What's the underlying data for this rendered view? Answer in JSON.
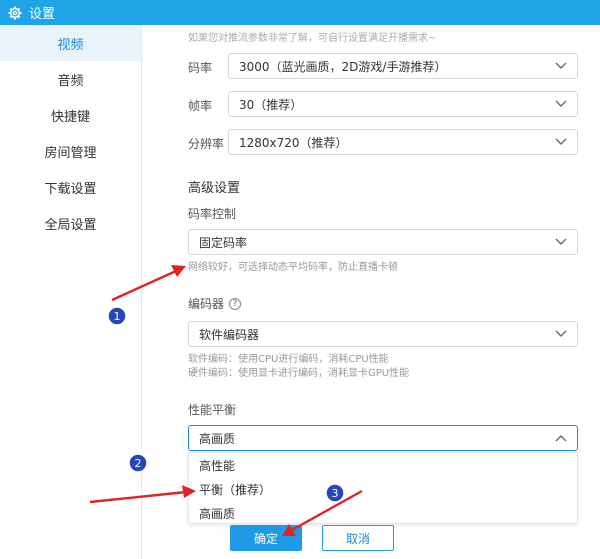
{
  "window": {
    "title": "设置",
    "icon": "gear-icon"
  },
  "sidebar": {
    "items": [
      {
        "label": "视频",
        "active": true
      },
      {
        "label": "音频"
      },
      {
        "label": "快捷键"
      },
      {
        "label": "房间管理"
      },
      {
        "label": "下载设置"
      },
      {
        "label": "全局设置"
      }
    ]
  },
  "main": {
    "top_hint": "如果您对推流参数非常了解，可自行设置满足开播需求~",
    "bitrate": {
      "label": "码率",
      "value": "3000（蓝光画质，2D游戏/手游推荐）"
    },
    "framerate": {
      "label": "帧率",
      "value": "30（推荐）"
    },
    "resolution": {
      "label": "分辨率",
      "value": "1280x720（推荐）"
    },
    "advanced_title": "高级设置",
    "rate_control": {
      "label": "码率控制",
      "value": "固定码率",
      "note": "网络较好，可选择动态平均码率，防止直播卡顿"
    },
    "encoder": {
      "label": "编码器",
      "help": "?",
      "value": "软件编码器",
      "note_software": "软件编码：使用CPU进行编码，消耗CPU性能",
      "note_hardware": "硬件编码：使用显卡进行编码，消耗显卡GPU性能"
    },
    "performance": {
      "label": "性能平衡",
      "value": "高画质",
      "options": [
        "高性能",
        "平衡（推荐）",
        "高画质"
      ]
    }
  },
  "footer": {
    "ok_label": "确定",
    "cancel_label": "取消"
  },
  "annotations": [
    {
      "number": "1"
    },
    {
      "number": "2"
    },
    {
      "number": "3"
    }
  ],
  "colors": {
    "accent": "#1e9be8",
    "titlebar": "#1fa4e8",
    "arrow": "#e02424",
    "badge": "#2547b8"
  }
}
